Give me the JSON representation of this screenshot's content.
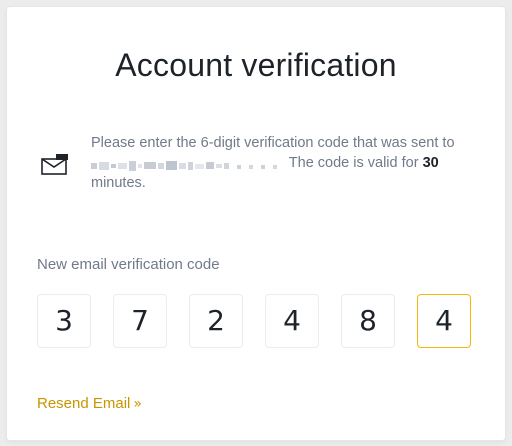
{
  "title": "Account verification",
  "description": {
    "prefix": "Please enter the 6-digit verification code that was sent to",
    "email_masked": "",
    "middle": " The code is valid for ",
    "duration": "30",
    "suffix": "minutes."
  },
  "code_label": "New email verification code",
  "code_digits": [
    "3",
    "7",
    "2",
    "4",
    "8",
    "4"
  ],
  "active_index": 5,
  "resend_label": "Resend Email",
  "resend_chevron": "»",
  "icons": {
    "mail": "mail-icon",
    "resend": "double-chevron-right-icon"
  },
  "colors": {
    "accent": "#F0B90B",
    "link": "#C99400",
    "text": "#1E2329",
    "muted": "#707A8A",
    "border": "#EAECEF"
  }
}
